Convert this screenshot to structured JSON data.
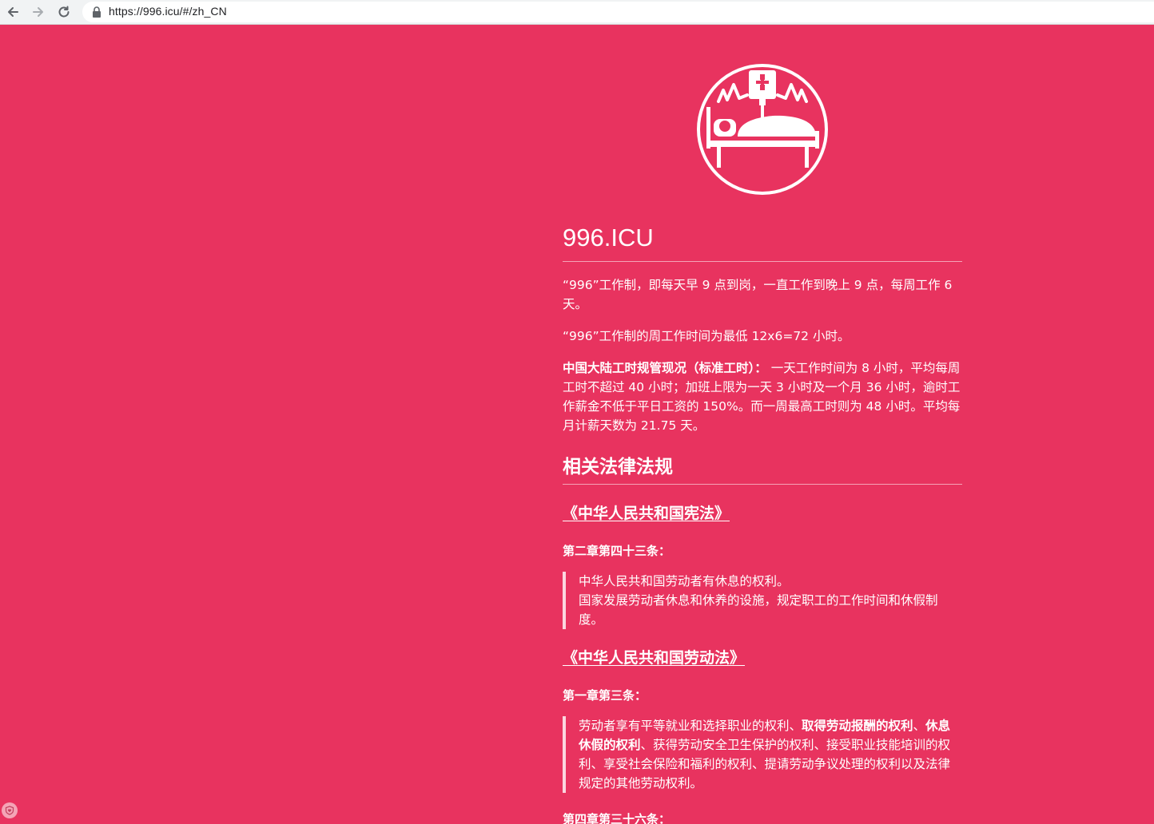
{
  "browser": {
    "url": "https://996.icu/#/zh_CN",
    "back_icon": "arrow-left-icon",
    "forward_icon": "arrow-right-icon",
    "reload_icon": "reload-icon",
    "lock_icon": "lock-icon"
  },
  "colors": {
    "page_bg": "#e8335f",
    "text": "#ffffff",
    "chrome_bg": "#f1f3f4"
  },
  "logo": {
    "icon": "hospital-bed-icon"
  },
  "title": "996.ICU",
  "intro": {
    "p1": "“996”工作制，即每天早 9 点到岗，一直工作到晚上 9 点，每周工作 6 天。",
    "p2": "“996”工作制的周工作时间为最低 12x6=72 小时。",
    "p3_bold": "中国大陆工时规管现况（标准工时）：",
    "p3_rest": " 一天工作时间为 8 小时，平均每周工时不超过 40 小时；加班上限为一天 3 小时及一个月 36 小时，逾时工作薪金不低于平日工资的 150%。而一周最高工时则为 48 小时。平均每月计薪天数为 21.75 天。"
  },
  "section_title": "相关法律法规",
  "laws": [
    {
      "title": "《中华人民共和国宪法》",
      "chapter": "第二章第四十三条：",
      "quote_line1": "中华人民共和国劳动者有休息的权利。",
      "quote_line2": "国家发展劳动者休息和休养的设施，规定职工的工作时间和休假制度。"
    },
    {
      "title": "《中华人民共和国劳动法》",
      "chapter": "第一章第三条：",
      "quote_a": "劳动者享有平等就业和选择职业的权利、",
      "quote_b_bold": "取得劳动报酬的权利",
      "quote_c": "、",
      "quote_d_bold": "休息休假的权利",
      "quote_e": "、获得劳动安全卫生保护的权利、接受职业技能培训的权利、享受社会保险和福利的权利、提请劳动争议处理的权利以及法律规定的其他劳动权利。",
      "next_chapter": "第四章第三十六条："
    }
  ],
  "extension": {
    "icon": "shield-heart-icon"
  }
}
